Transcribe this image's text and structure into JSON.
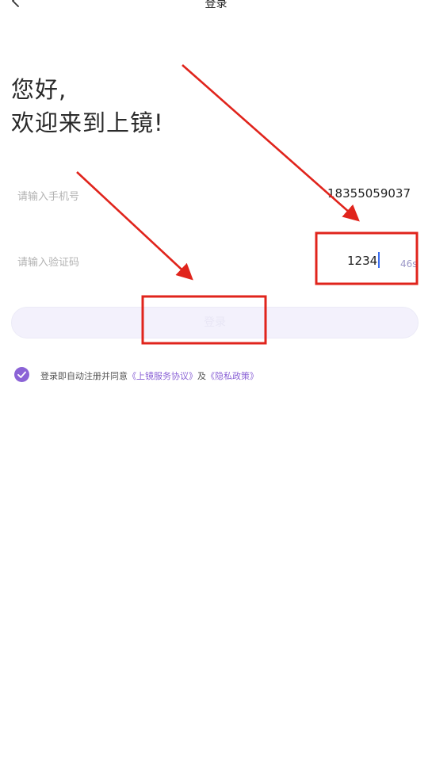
{
  "header": {
    "title": "登录",
    "back_icon": "chevron-left-icon"
  },
  "greeting": {
    "line1": "您好,",
    "line2": "欢迎来到上镜!"
  },
  "phone_field": {
    "placeholder": "请输入手机号",
    "value": "18355059037"
  },
  "code_field": {
    "placeholder": "请输入验证码",
    "value": "1234",
    "countdown": "46s"
  },
  "login_button": {
    "label": "登录"
  },
  "agreement": {
    "checked": true,
    "check_icon": "check-circle-icon",
    "prefix": "登录即自动注册并同意",
    "link1": "《上镜服务协议》",
    "middle": "及",
    "link2": "《隐私政策》"
  },
  "colors": {
    "accent": "#8b63d6",
    "annotation": "#e0241c",
    "button_bg": "#f3f1fc",
    "placeholder": "#b3b3b3"
  }
}
